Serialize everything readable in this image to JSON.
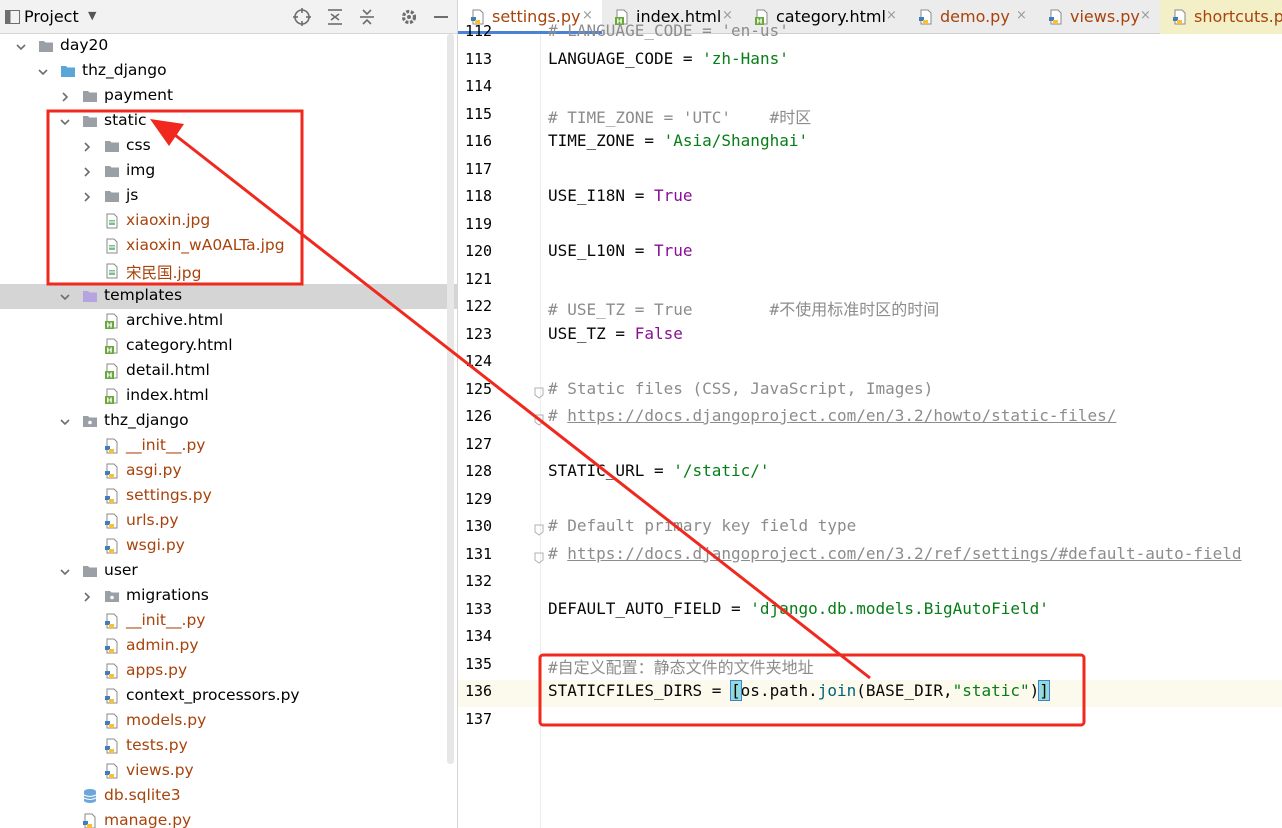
{
  "project_panel": {
    "title": "Project",
    "tree": [
      {
        "label": "day20",
        "depth": 0,
        "kind": "folder",
        "expanded": true,
        "color": "black"
      },
      {
        "label": "thz_django",
        "depth": 1,
        "kind": "folder-blue",
        "expanded": true,
        "color": "black"
      },
      {
        "label": "payment",
        "depth": 2,
        "kind": "folder",
        "expanded": false,
        "color": "black"
      },
      {
        "label": "static",
        "depth": 2,
        "kind": "folder",
        "expanded": true,
        "color": "black"
      },
      {
        "label": "css",
        "depth": 3,
        "kind": "folder",
        "expanded": false,
        "color": "black"
      },
      {
        "label": "img",
        "depth": 3,
        "kind": "folder",
        "expanded": false,
        "color": "black"
      },
      {
        "label": "js",
        "depth": 3,
        "kind": "folder",
        "expanded": false,
        "color": "black"
      },
      {
        "label": "xiaoxin.jpg",
        "depth": 3,
        "kind": "image",
        "color": "orange"
      },
      {
        "label": "xiaoxin_wA0ALTa.jpg",
        "depth": 3,
        "kind": "image",
        "color": "orange"
      },
      {
        "label": "宋民国.jpg",
        "depth": 3,
        "kind": "image",
        "color": "orange"
      },
      {
        "label": "templates",
        "depth": 2,
        "kind": "folder-purple",
        "expanded": true,
        "color": "black",
        "selected": true
      },
      {
        "label": "archive.html",
        "depth": 3,
        "kind": "html",
        "color": "black"
      },
      {
        "label": "category.html",
        "depth": 3,
        "kind": "html",
        "color": "black"
      },
      {
        "label": "detail.html",
        "depth": 3,
        "kind": "html",
        "color": "black"
      },
      {
        "label": "index.html",
        "depth": 3,
        "kind": "html",
        "color": "black"
      },
      {
        "label": "thz_django",
        "depth": 2,
        "kind": "folder-dot",
        "expanded": true,
        "color": "black"
      },
      {
        "label": "__init__.py",
        "depth": 3,
        "kind": "python",
        "color": "orange"
      },
      {
        "label": "asgi.py",
        "depth": 3,
        "kind": "python",
        "color": "orange"
      },
      {
        "label": "settings.py",
        "depth": 3,
        "kind": "python",
        "color": "orange"
      },
      {
        "label": "urls.py",
        "depth": 3,
        "kind": "python",
        "color": "orange"
      },
      {
        "label": "wsgi.py",
        "depth": 3,
        "kind": "python",
        "color": "orange"
      },
      {
        "label": "user",
        "depth": 2,
        "kind": "folder",
        "expanded": true,
        "color": "black"
      },
      {
        "label": "migrations",
        "depth": 3,
        "kind": "folder-dot",
        "expanded": false,
        "color": "black"
      },
      {
        "label": "__init__.py",
        "depth": 3,
        "kind": "python",
        "color": "orange"
      },
      {
        "label": "admin.py",
        "depth": 3,
        "kind": "python",
        "color": "orange"
      },
      {
        "label": "apps.py",
        "depth": 3,
        "kind": "python",
        "color": "orange"
      },
      {
        "label": "context_processors.py",
        "depth": 3,
        "kind": "python",
        "color": "black"
      },
      {
        "label": "models.py",
        "depth": 3,
        "kind": "python",
        "color": "orange"
      },
      {
        "label": "tests.py",
        "depth": 3,
        "kind": "python",
        "color": "orange"
      },
      {
        "label": "views.py",
        "depth": 3,
        "kind": "python",
        "color": "orange"
      },
      {
        "label": "db.sqlite3",
        "depth": 2,
        "kind": "db",
        "color": "orange"
      },
      {
        "label": "manage.py",
        "depth": 2,
        "kind": "python",
        "color": "orange"
      }
    ]
  },
  "tabs": [
    {
      "label": "settings.py",
      "kind": "python",
      "active": true
    },
    {
      "label": "index.html",
      "kind": "html"
    },
    {
      "label": "category.html",
      "kind": "html"
    },
    {
      "label": "demo.py",
      "kind": "python"
    },
    {
      "label": "views.py",
      "kind": "python"
    },
    {
      "label": "shortcuts.py",
      "kind": "python",
      "pinned": true
    }
  ],
  "tab_close": "×",
  "editor": {
    "current_line": 136,
    "lines": [
      {
        "n": 112,
        "tokens": [
          {
            "t": "# LANGUAGE_CODE = 'en-us'",
            "c": "comment"
          }
        ]
      },
      {
        "n": 113,
        "tokens": [
          {
            "t": "LANGUAGE_CODE",
            "c": "op"
          },
          {
            "t": " = ",
            "c": "op"
          },
          {
            "t": "'zh-Hans'",
            "c": "string"
          }
        ]
      },
      {
        "n": 114,
        "tokens": []
      },
      {
        "n": 115,
        "tokens": [
          {
            "t": "# TIME_ZONE = 'UTC'    #时区",
            "c": "comment"
          }
        ]
      },
      {
        "n": 116,
        "tokens": [
          {
            "t": "TIME_ZONE",
            "c": "op"
          },
          {
            "t": " = ",
            "c": "op"
          },
          {
            "t": "'Asia/Shanghai'",
            "c": "string"
          }
        ]
      },
      {
        "n": 117,
        "tokens": []
      },
      {
        "n": 118,
        "tokens": [
          {
            "t": "USE_I18N",
            "c": "op"
          },
          {
            "t": " = ",
            "c": "op"
          },
          {
            "t": "True",
            "c": "true"
          }
        ]
      },
      {
        "n": 119,
        "tokens": []
      },
      {
        "n": 120,
        "tokens": [
          {
            "t": "USE_L10N",
            "c": "op"
          },
          {
            "t": " = ",
            "c": "op"
          },
          {
            "t": "True",
            "c": "true"
          }
        ]
      },
      {
        "n": 121,
        "tokens": []
      },
      {
        "n": 122,
        "tokens": [
          {
            "t": "# USE_TZ = True        #不使用标准时区的时间",
            "c": "comment"
          }
        ]
      },
      {
        "n": 123,
        "tokens": [
          {
            "t": "USE_TZ",
            "c": "op"
          },
          {
            "t": " = ",
            "c": "op"
          },
          {
            "t": "False",
            "c": "true"
          }
        ]
      },
      {
        "n": 124,
        "tokens": []
      },
      {
        "n": 125,
        "tokens": [
          {
            "t": "# Static files (CSS, JavaScript, Images)",
            "c": "comment"
          }
        ]
      },
      {
        "n": 126,
        "tokens": [
          {
            "t": "# ",
            "c": "comment"
          },
          {
            "t": "https://docs.djangoproject.com/en/3.2/howto/static-files/",
            "c": "link"
          }
        ]
      },
      {
        "n": 127,
        "tokens": []
      },
      {
        "n": 128,
        "tokens": [
          {
            "t": "STATIC_URL",
            "c": "op"
          },
          {
            "t": " = ",
            "c": "op"
          },
          {
            "t": "'/static/'",
            "c": "string"
          }
        ]
      },
      {
        "n": 129,
        "tokens": []
      },
      {
        "n": 130,
        "tokens": [
          {
            "t": "# Default primary key field type",
            "c": "comment"
          }
        ]
      },
      {
        "n": 131,
        "tokens": [
          {
            "t": "# ",
            "c": "comment"
          },
          {
            "t": "https://docs.djangoproject.com/en/3.2/ref/settings/#default-auto-field",
            "c": "link"
          }
        ]
      },
      {
        "n": 132,
        "tokens": []
      },
      {
        "n": 133,
        "tokens": [
          {
            "t": "DEFAULT_AUTO_FIELD",
            "c": "op"
          },
          {
            "t": " = ",
            "c": "op"
          },
          {
            "t": "'django.db.models.BigAutoField'",
            "c": "string"
          }
        ]
      },
      {
        "n": 134,
        "tokens": []
      },
      {
        "n": 135,
        "tokens": [
          {
            "t": "#自定义配置：静态文件的文件夹地址",
            "c": "comment"
          }
        ]
      },
      {
        "n": 136,
        "tokens": [
          {
            "t": "STATICFILES_DIRS",
            "c": "op"
          },
          {
            "t": " = ",
            "c": "op"
          },
          {
            "t": "[",
            "c": "br"
          },
          {
            "t": "os.path.",
            "c": "op"
          },
          {
            "t": "join",
            "c": "fn"
          },
          {
            "t": "(BASE_DIR,",
            "c": "op"
          },
          {
            "t": "\"static\"",
            "c": "string"
          },
          {
            "t": ")",
            "c": "op"
          },
          {
            "t": "]",
            "c": "br"
          }
        ]
      },
      {
        "n": 137,
        "tokens": []
      }
    ]
  },
  "colors": {
    "annotation_red": "#f0281e",
    "folder_gray": "#9aa0a6",
    "folder_blue": "#5aa6d8",
    "folder_purple": "#b6a4e0",
    "html_green": "#6aa83c",
    "python_blue": "#3f7dbf",
    "python_yellow": "#f4c13a"
  }
}
